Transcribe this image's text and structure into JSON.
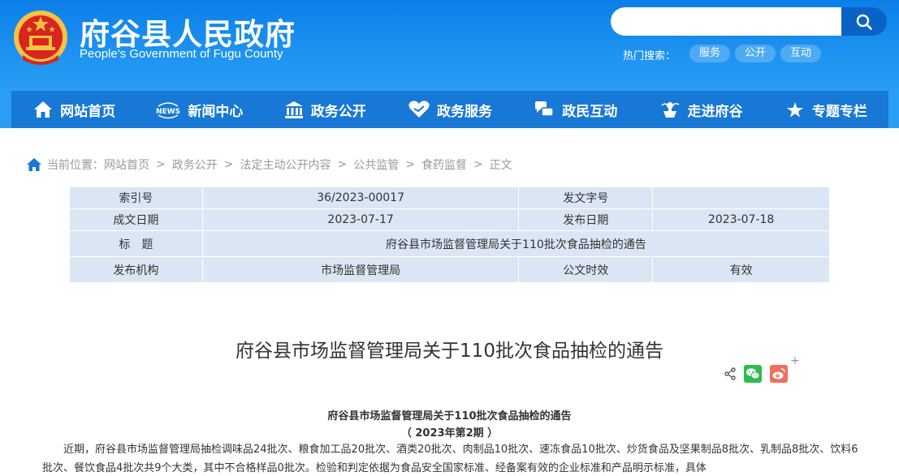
{
  "header": {
    "title": "府谷县人民政府",
    "subtitle": "People's Government of Fugu County",
    "search": {
      "placeholder": "",
      "value": ""
    },
    "hot_label": "热门搜索：",
    "hot_tags": [
      "服务",
      "公开",
      "互动"
    ]
  },
  "nav": {
    "items": [
      {
        "label": "网站首页",
        "icon": "home-icon"
      },
      {
        "label": "新闻中心",
        "icon": "news-icon"
      },
      {
        "label": "政务公开",
        "icon": "government-building-icon"
      },
      {
        "label": "政务服务",
        "icon": "heart-service-icon"
      },
      {
        "label": "政民互动",
        "icon": "interaction-icon"
      },
      {
        "label": "走进府谷",
        "icon": "landmark-icon"
      },
      {
        "label": "专题专栏",
        "icon": "star-badge-icon"
      }
    ]
  },
  "breadcrumb": {
    "prefix": "当前位置：",
    "items": [
      "网站首页",
      "政务公开",
      "法定主动公开内容",
      "公共监管",
      "食药监督",
      "正文"
    ],
    "separator": ">"
  },
  "meta": {
    "rows": [
      {
        "k1": "索引号",
        "v1": "36/2023-00017",
        "k2": "发文字号",
        "v2": ""
      },
      {
        "k1": "成文日期",
        "v1": "2023-07-17",
        "k2": "发布日期",
        "v2": "2023-07-18"
      },
      {
        "k1": "标　题",
        "v1": "府谷县市场监督管理局关于110批次食品抽检的通告"
      },
      {
        "k1": "发布机构",
        "v1": "市场监督管理局",
        "k2": "公文时效",
        "v2": "有效"
      }
    ]
  },
  "article": {
    "title": "府谷县市场监督管理局关于110批次食品抽检的通告",
    "share_plus": "+",
    "doc_title": "府谷县市场监督管理局关于110批次食品抽检的通告",
    "doc_issue": "（ 2023年第2期 ）",
    "body": "近期，府谷县市场监督管理局抽检调味品24批次、粮食加工品20批次、酒类20批次、肉制品10批次、速冻食品10批次、炒货食品及坚果制品8批次、乳制品8批次、饮料6批次、餐饮食品4批次共9个大类，其中不合格样品0批次。检验和判定依据为食品安全国家标准、经备案有效的企业标准和产品明示标准，具体"
  },
  "colors": {
    "header_blue": "#1e93f0",
    "nav_blue": "#1778d5",
    "table_bg": "#dbe6f5",
    "wechat_green": "#2dbb4d",
    "weibo_red": "#f06f5c"
  }
}
